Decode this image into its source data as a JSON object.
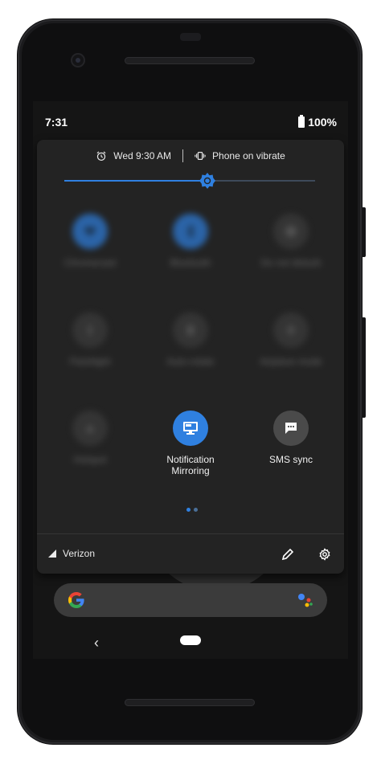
{
  "status_bar": {
    "time": "7:31",
    "battery": "100%"
  },
  "quick_settings": {
    "header": {
      "alarm_text": "Wed 9:30 AM",
      "alarm_icon": "alarm-clock-icon",
      "ringer_text": "Phone on vibrate",
      "ringer_icon": "vibrate-icon"
    },
    "brightness": {
      "level": 0.57
    },
    "tiles": [
      {
        "label": "Chromecast",
        "icon": "heart-icon",
        "state": "on",
        "blurred": true
      },
      {
        "label": "Bluetooth",
        "icon": "bluetooth-icon",
        "state": "on",
        "blurred": true
      },
      {
        "label": "Do not disturb",
        "icon": "dnd-icon",
        "state": "off",
        "blurred": true
      },
      {
        "label": "Flashlight",
        "icon": "flashlight-icon",
        "state": "off",
        "blurred": true
      },
      {
        "label": "Auto-rotate",
        "icon": "rotate-icon",
        "state": "off",
        "blurred": true
      },
      {
        "label": "Airplane mode",
        "icon": "airplane-icon",
        "state": "off",
        "blurred": true
      },
      {
        "label": "Hotspot",
        "icon": "hotspot-icon",
        "state": "off",
        "blurred": true
      },
      {
        "label_line1": "Notification",
        "label_line2": "Mirroring",
        "icon": "monitor-icon",
        "state": "on",
        "blurred": false
      },
      {
        "label": "SMS sync",
        "icon": "message-icon",
        "state": "off",
        "blurred": false
      }
    ],
    "page_indicator": {
      "pages": 2,
      "current": 1
    },
    "footer": {
      "carrier": "Verizon",
      "edit_icon": "pencil-icon",
      "settings_icon": "gear-icon"
    }
  },
  "colors": {
    "accent": "#2f80e0",
    "panel": "#232323",
    "tile_off": "#3c3c3c"
  }
}
